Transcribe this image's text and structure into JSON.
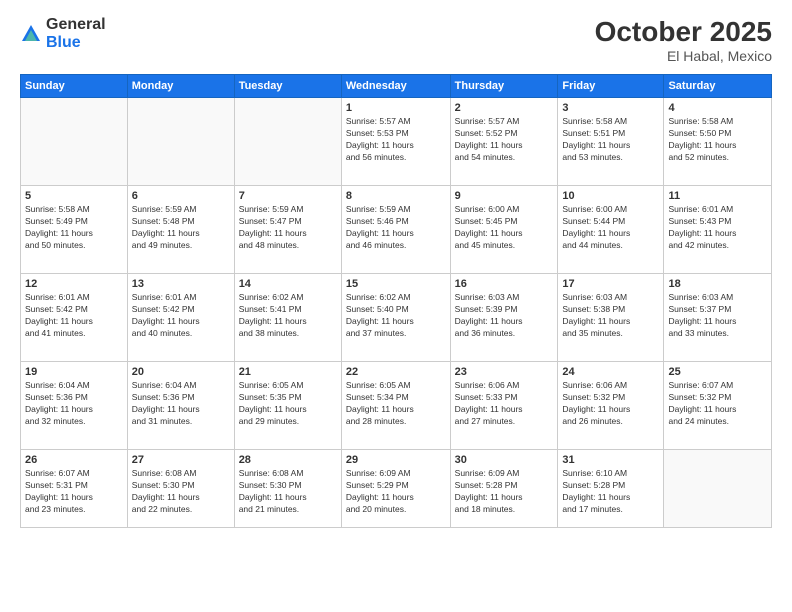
{
  "header": {
    "logo_line1": "General",
    "logo_line2": "Blue",
    "month": "October 2025",
    "location": "El Habal, Mexico"
  },
  "weekdays": [
    "Sunday",
    "Monday",
    "Tuesday",
    "Wednesday",
    "Thursday",
    "Friday",
    "Saturday"
  ],
  "weeks": [
    [
      {
        "day": "",
        "info": ""
      },
      {
        "day": "",
        "info": ""
      },
      {
        "day": "",
        "info": ""
      },
      {
        "day": "1",
        "info": "Sunrise: 5:57 AM\nSunset: 5:53 PM\nDaylight: 11 hours\nand 56 minutes."
      },
      {
        "day": "2",
        "info": "Sunrise: 5:57 AM\nSunset: 5:52 PM\nDaylight: 11 hours\nand 54 minutes."
      },
      {
        "day": "3",
        "info": "Sunrise: 5:58 AM\nSunset: 5:51 PM\nDaylight: 11 hours\nand 53 minutes."
      },
      {
        "day": "4",
        "info": "Sunrise: 5:58 AM\nSunset: 5:50 PM\nDaylight: 11 hours\nand 52 minutes."
      }
    ],
    [
      {
        "day": "5",
        "info": "Sunrise: 5:58 AM\nSunset: 5:49 PM\nDaylight: 11 hours\nand 50 minutes."
      },
      {
        "day": "6",
        "info": "Sunrise: 5:59 AM\nSunset: 5:48 PM\nDaylight: 11 hours\nand 49 minutes."
      },
      {
        "day": "7",
        "info": "Sunrise: 5:59 AM\nSunset: 5:47 PM\nDaylight: 11 hours\nand 48 minutes."
      },
      {
        "day": "8",
        "info": "Sunrise: 5:59 AM\nSunset: 5:46 PM\nDaylight: 11 hours\nand 46 minutes."
      },
      {
        "day": "9",
        "info": "Sunrise: 6:00 AM\nSunset: 5:45 PM\nDaylight: 11 hours\nand 45 minutes."
      },
      {
        "day": "10",
        "info": "Sunrise: 6:00 AM\nSunset: 5:44 PM\nDaylight: 11 hours\nand 44 minutes."
      },
      {
        "day": "11",
        "info": "Sunrise: 6:01 AM\nSunset: 5:43 PM\nDaylight: 11 hours\nand 42 minutes."
      }
    ],
    [
      {
        "day": "12",
        "info": "Sunrise: 6:01 AM\nSunset: 5:42 PM\nDaylight: 11 hours\nand 41 minutes."
      },
      {
        "day": "13",
        "info": "Sunrise: 6:01 AM\nSunset: 5:42 PM\nDaylight: 11 hours\nand 40 minutes."
      },
      {
        "day": "14",
        "info": "Sunrise: 6:02 AM\nSunset: 5:41 PM\nDaylight: 11 hours\nand 38 minutes."
      },
      {
        "day": "15",
        "info": "Sunrise: 6:02 AM\nSunset: 5:40 PM\nDaylight: 11 hours\nand 37 minutes."
      },
      {
        "day": "16",
        "info": "Sunrise: 6:03 AM\nSunset: 5:39 PM\nDaylight: 11 hours\nand 36 minutes."
      },
      {
        "day": "17",
        "info": "Sunrise: 6:03 AM\nSunset: 5:38 PM\nDaylight: 11 hours\nand 35 minutes."
      },
      {
        "day": "18",
        "info": "Sunrise: 6:03 AM\nSunset: 5:37 PM\nDaylight: 11 hours\nand 33 minutes."
      }
    ],
    [
      {
        "day": "19",
        "info": "Sunrise: 6:04 AM\nSunset: 5:36 PM\nDaylight: 11 hours\nand 32 minutes."
      },
      {
        "day": "20",
        "info": "Sunrise: 6:04 AM\nSunset: 5:36 PM\nDaylight: 11 hours\nand 31 minutes."
      },
      {
        "day": "21",
        "info": "Sunrise: 6:05 AM\nSunset: 5:35 PM\nDaylight: 11 hours\nand 29 minutes."
      },
      {
        "day": "22",
        "info": "Sunrise: 6:05 AM\nSunset: 5:34 PM\nDaylight: 11 hours\nand 28 minutes."
      },
      {
        "day": "23",
        "info": "Sunrise: 6:06 AM\nSunset: 5:33 PM\nDaylight: 11 hours\nand 27 minutes."
      },
      {
        "day": "24",
        "info": "Sunrise: 6:06 AM\nSunset: 5:32 PM\nDaylight: 11 hours\nand 26 minutes."
      },
      {
        "day": "25",
        "info": "Sunrise: 6:07 AM\nSunset: 5:32 PM\nDaylight: 11 hours\nand 24 minutes."
      }
    ],
    [
      {
        "day": "26",
        "info": "Sunrise: 6:07 AM\nSunset: 5:31 PM\nDaylight: 11 hours\nand 23 minutes."
      },
      {
        "day": "27",
        "info": "Sunrise: 6:08 AM\nSunset: 5:30 PM\nDaylight: 11 hours\nand 22 minutes."
      },
      {
        "day": "28",
        "info": "Sunrise: 6:08 AM\nSunset: 5:30 PM\nDaylight: 11 hours\nand 21 minutes."
      },
      {
        "day": "29",
        "info": "Sunrise: 6:09 AM\nSunset: 5:29 PM\nDaylight: 11 hours\nand 20 minutes."
      },
      {
        "day": "30",
        "info": "Sunrise: 6:09 AM\nSunset: 5:28 PM\nDaylight: 11 hours\nand 18 minutes."
      },
      {
        "day": "31",
        "info": "Sunrise: 6:10 AM\nSunset: 5:28 PM\nDaylight: 11 hours\nand 17 minutes."
      },
      {
        "day": "",
        "info": ""
      }
    ]
  ]
}
